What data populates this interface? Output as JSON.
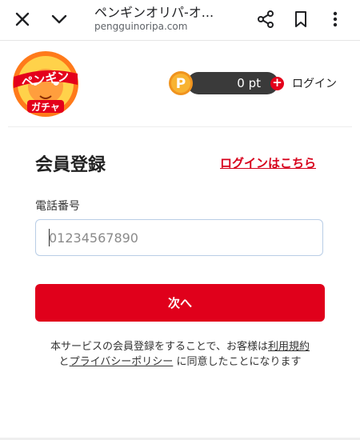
{
  "browser": {
    "title": "ペンギンオリパ-オ...",
    "url": "pengguinoripa.com"
  },
  "header": {
    "logo_line1": "ペンギン",
    "logo_line2": "ガチャ",
    "coin_letter": "P",
    "points": "0 pt",
    "plus": "+",
    "login": "ログイン"
  },
  "form": {
    "title": "会員登録",
    "login_here": "ログインはこちら",
    "phone_label": "電話番号",
    "phone_placeholder": "01234567890",
    "phone_value": "",
    "next_button": "次へ"
  },
  "terms": {
    "text_1": "本サービスの会員登録をすることで、お客様は",
    "link_terms": "利用規約",
    "text_2": "と",
    "link_privacy": "プライバシーポリシー",
    "text_3": " に同意したことになります"
  },
  "colors": {
    "accent": "#e0001b",
    "link": "#d7001b",
    "points_pill": "#3a3a3a",
    "coin": "#f5a623"
  }
}
